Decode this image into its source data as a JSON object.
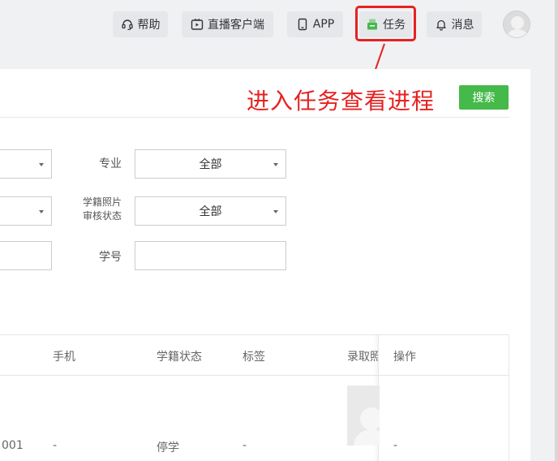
{
  "nav": {
    "help_label": "帮助",
    "live_label": "直播客户端",
    "app_label": "APP",
    "task_label": "任务",
    "message_label": "消息"
  },
  "annotation": {
    "text": "进入任务查看进程",
    "color": "#e52222"
  },
  "search": {
    "label": "搜索",
    "color": "#45b94a"
  },
  "filters": {
    "major_label": "专业",
    "major_value": "全部",
    "photo_status_label_line1": "学籍照片",
    "photo_status_label_line2": "审核状态",
    "photo_status_value": "全部",
    "student_id_label": "学号",
    "student_id_value": ""
  },
  "table": {
    "headers": {
      "phone": "手机",
      "status": "学籍状态",
      "tags": "标签",
      "admission_photo": "录取照",
      "operation": "操作"
    },
    "row": {
      "id_tail": "001",
      "phone": "-",
      "status": "停学",
      "tags": "-",
      "operation": "-"
    }
  }
}
